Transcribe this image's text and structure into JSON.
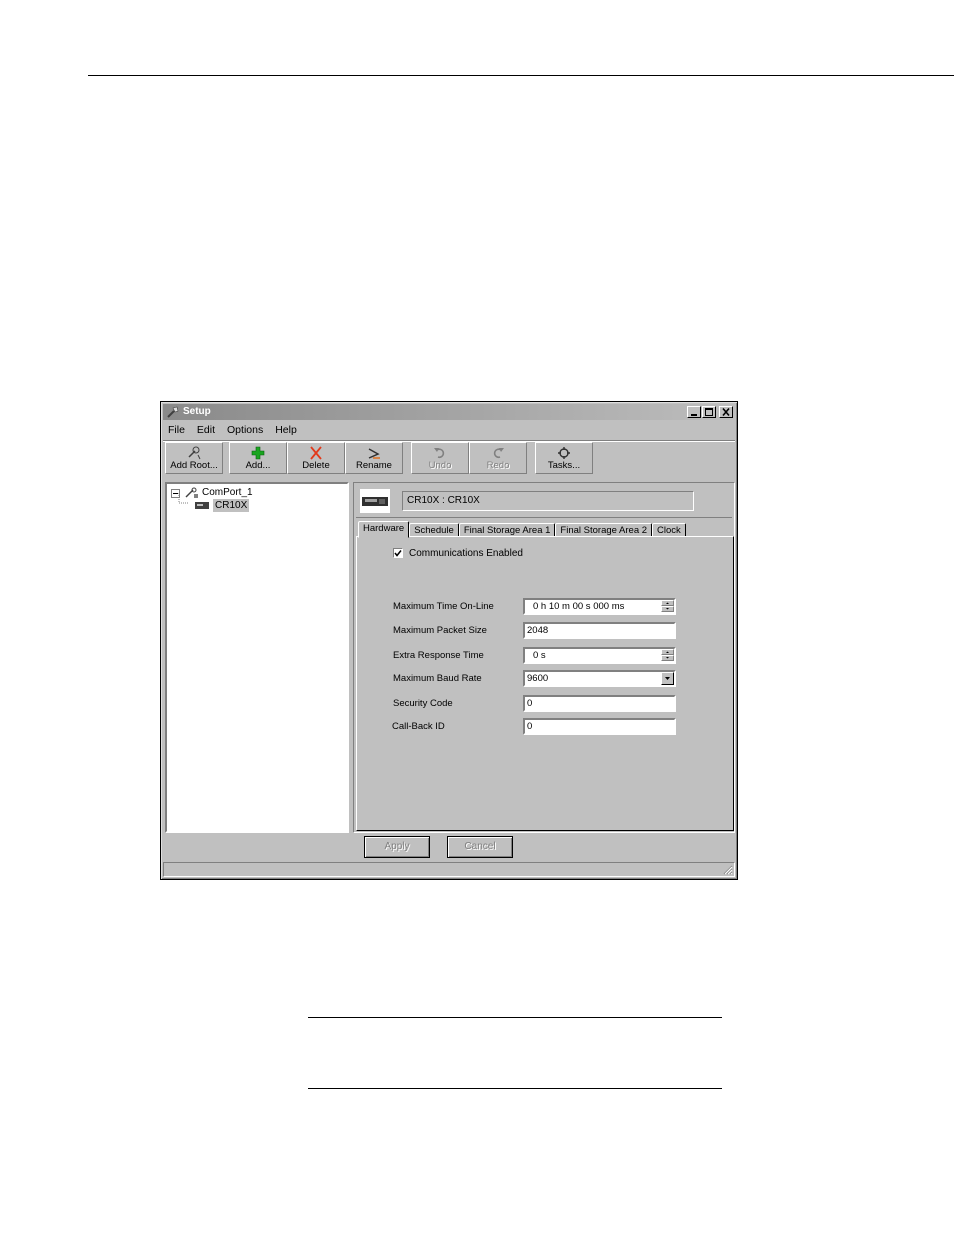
{
  "window": {
    "title": "Setup"
  },
  "menu": [
    "File",
    "Edit",
    "Options",
    "Help"
  ],
  "toolbar": {
    "add_root": "Add Root...",
    "add": "Add...",
    "delete": "Delete",
    "rename": "Rename",
    "undo": "Undo",
    "redo": "Redo",
    "tasks": "Tasks..."
  },
  "tree": {
    "root": "ComPort_1",
    "child": "CR10X"
  },
  "device": {
    "name": "CR10X : CR10X"
  },
  "tabs": [
    "Hardware",
    "Schedule",
    "Final Storage Area 1",
    "Final Storage Area 2",
    "Clock"
  ],
  "hardware": {
    "communications_enabled": "Communications Enabled",
    "fields": [
      {
        "label": "Maximum Time On-Line",
        "value": "0 h 10 m 00 s 000 ms"
      },
      {
        "label": "Maximum Packet Size",
        "value": "2048"
      },
      {
        "label": "Extra Response Time",
        "value": "0 s"
      },
      {
        "label": "Maximum Baud Rate",
        "value": "9600"
      },
      {
        "label": "Security Code",
        "value": "0"
      },
      {
        "label": "Call-Back ID",
        "value": "0"
      }
    ]
  },
  "buttons": {
    "apply": "Apply",
    "cancel": "Cancel"
  }
}
